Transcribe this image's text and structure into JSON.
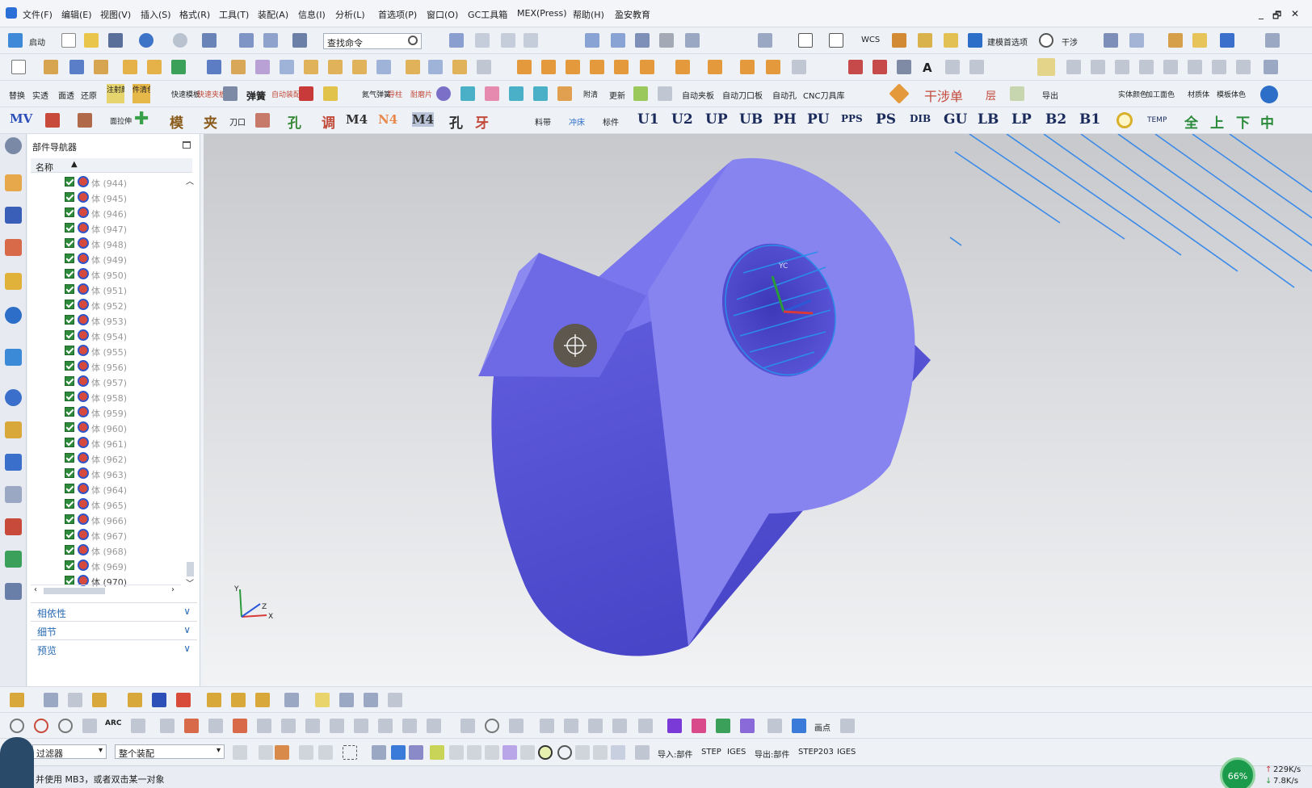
{
  "menubar": {
    "items": [
      "文件(F)",
      "编辑(E)",
      "视图(V)",
      "插入(S)",
      "格式(R)",
      "工具(T)",
      "装配(A)",
      "信息(I)",
      "分析(L)",
      "首选项(P)",
      "窗口(O)",
      "GC工具箱",
      "MEX(Press)",
      "帮助(H)",
      "盈安教育"
    ],
    "window_controls": [
      "_",
      "🗗",
      "✕"
    ]
  },
  "toolbar1": {
    "start_label": "启动",
    "search_placeholder": "查找命令",
    "wcs_label": "WCS",
    "modeling_pref_label": "建模首选项",
    "interference_label": "干涉"
  },
  "toolbar3": {
    "labels": [
      "替换",
      "实透",
      "面透",
      "还原",
      "注射颜色",
      "件清色",
      "快速模板",
      "快速夹板",
      "弹簧",
      "自动装配",
      "氮气弹簧",
      "导柱",
      "耐磨片",
      "附清",
      "更新",
      "自动夹板",
      "自动刀口板",
      "自动孔",
      "CNC刀具库",
      "干涉",
      "单",
      "层",
      "导出",
      "实体颜色",
      "加工面色",
      "材质体",
      "模板体色"
    ]
  },
  "toolbar4": {
    "labels": [
      "MV",
      "面拉伸",
      "模",
      "夹",
      "刀口",
      "孔",
      "调",
      "M4",
      "N4",
      "M4",
      "孔",
      "牙",
      "料带",
      "冲床",
      "标件",
      "U1",
      "U2",
      "UP",
      "UB",
      "PH",
      "PU",
      "PPS",
      "PS",
      "DIB",
      "GU",
      "LB",
      "LP",
      "B2",
      "B1",
      "TEMP",
      "全",
      "上",
      "下",
      "中"
    ]
  },
  "navigator": {
    "title": "部件导航器",
    "column_name": "名称",
    "rows": [
      "体 (944)",
      "体 (945)",
      "体 (946)",
      "体 (947)",
      "体 (948)",
      "体 (949)",
      "体 (950)",
      "体 (951)",
      "体 (952)",
      "体 (953)",
      "体 (954)",
      "体 (955)",
      "体 (956)",
      "体 (957)",
      "体 (958)",
      "体 (959)",
      "体 (960)",
      "体 (961)",
      "体 (962)",
      "体 (963)",
      "体 (964)",
      "体 (965)",
      "体 (966)",
      "体 (967)",
      "体 (968)",
      "体 (969)",
      "体 (970)"
    ],
    "accordion": [
      "相依性",
      "细节",
      "预览"
    ]
  },
  "viewport": {
    "wcs_label": "YC",
    "triad_labels": [
      "Y",
      "Z",
      "X"
    ],
    "colors": {
      "body_top": "#8a86ee",
      "body_side": "#5f5ce0",
      "hole": "#4540c8",
      "wire": "#2b8de8"
    }
  },
  "bottombar": {
    "filter_value": "过滤器",
    "assembly_value": "整个装配",
    "import_label": "导入:部件",
    "step_label": "STEP",
    "iges_label": "IGES",
    "export_label": "导出:部件",
    "step203_label": "STEP203",
    "iges2_label": "IGES",
    "draw_label": "画点"
  },
  "status": {
    "message": "并使用 MB3，或者双击某一对象",
    "net_percent": "66%",
    "upload": "229K/s",
    "download": "7.8K/s"
  }
}
